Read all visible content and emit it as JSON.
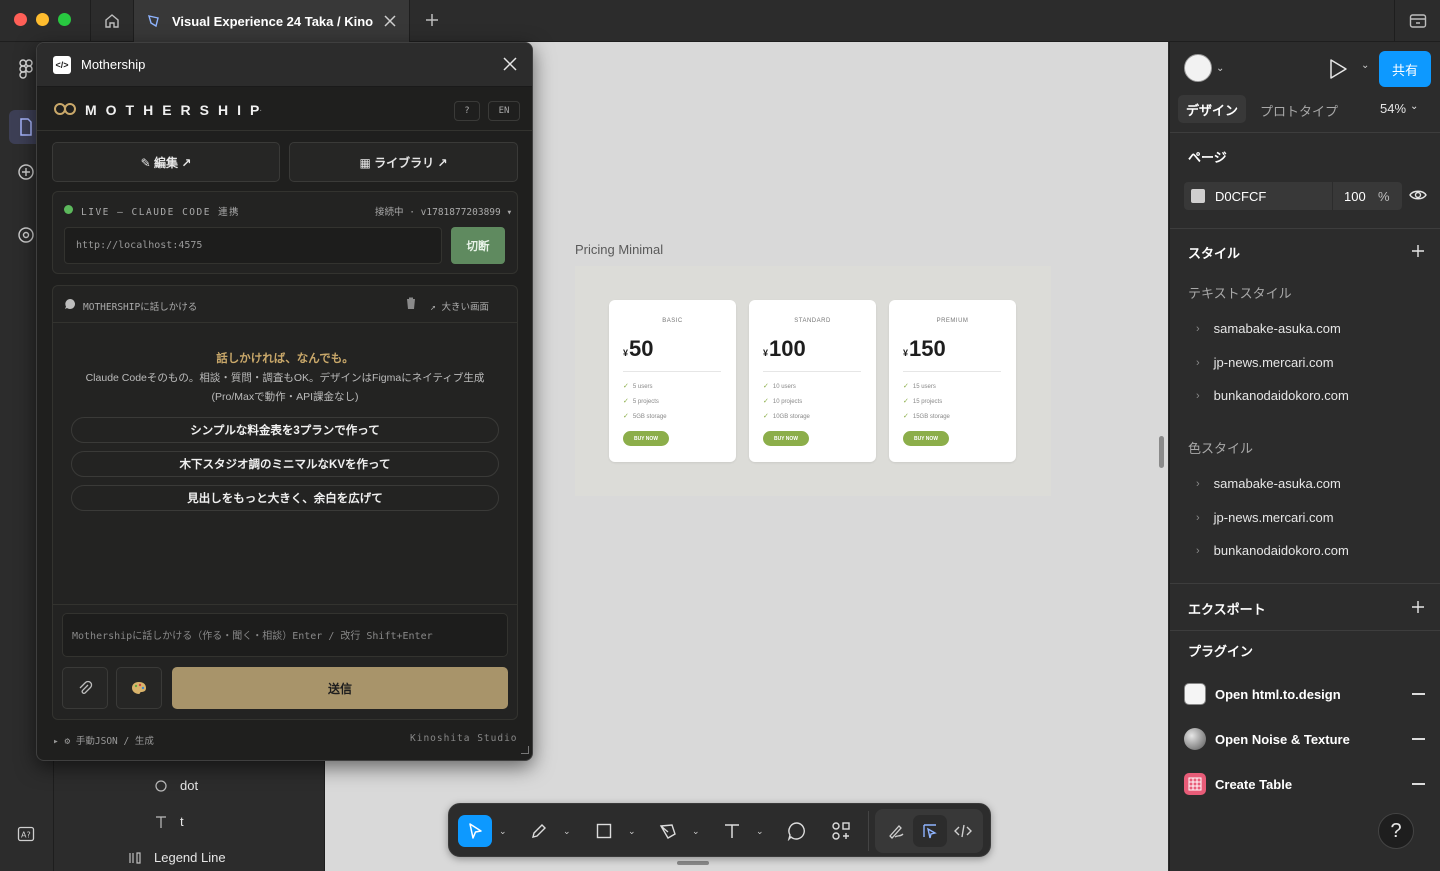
{
  "window": {
    "tab_title": "Visual Experience 24 Taka / Kino",
    "traffic_colors": [
      "#ff5f57",
      "#febc2e",
      "#28c840"
    ]
  },
  "layers": {
    "items": [
      {
        "label": "dot",
        "icon": "ellipse-icon"
      },
      {
        "label": "t",
        "icon": "text-icon"
      },
      {
        "label": "Legend Line",
        "icon": "frame-icon"
      }
    ]
  },
  "canvas": {
    "frame_label": "Pricing Minimal",
    "accent": "#8cae4a",
    "cards": [
      {
        "tier": "BASIC",
        "currency": "¥",
        "price": "50",
        "features": [
          "5 users",
          "5 projects",
          "5GB storage"
        ],
        "button": "BUY NOW"
      },
      {
        "tier": "STANDARD",
        "currency": "¥",
        "price": "100",
        "features": [
          "10 users",
          "10 projects",
          "10GB storage"
        ],
        "button": "BUY NOW"
      },
      {
        "tier": "PREMIUM",
        "currency": "¥",
        "price": "150",
        "features": [
          "15 users",
          "15 projects",
          "15GB storage"
        ],
        "button": "BUY NOW"
      }
    ]
  },
  "toolbar": {
    "tools": [
      "move-tool-icon",
      "pencil-icon",
      "rectangle-icon",
      "pen-icon",
      "text-tool-icon",
      "comment-icon",
      "actions-icon",
      "draw-mode-icon",
      "design-mode-icon",
      "dev-mode-icon"
    ]
  },
  "right": {
    "share_label": "共有",
    "share_color": "#0d99ff",
    "tabs": {
      "design": "デザイン",
      "prototype": "プロトタイプ"
    },
    "zoom": "54%",
    "page_section": "ページ",
    "bg_hex": "D0CFCF",
    "bg_opacity": "100",
    "bg_unit": "%",
    "styles_section": "スタイル",
    "text_styles": "テキストスタイル",
    "text_style_items": [
      "samabake-asuka.com",
      "jp-news.mercari.com",
      "bunkanodaidokoro.com"
    ],
    "color_styles": "色スタイル",
    "color_style_items": [
      "samabake-asuka.com",
      "jp-news.mercari.com",
      "bunkanodaidokoro.com"
    ],
    "export_section": "エクスポート",
    "plugins_section": "プラグイン",
    "plugins": [
      {
        "label": "Open html.to.design",
        "icon": "html-to-design-icon"
      },
      {
        "label": "Open Noise & Texture",
        "icon": "noise-texture-icon"
      },
      {
        "label": "Create Table",
        "icon": "table-icon"
      }
    ],
    "help": "?"
  },
  "modal": {
    "title": "Mothership",
    "brand": "MOTHERSHIP",
    "help_btn": "?",
    "lang_btn": "EN",
    "edit_btn": "✎ 編集 ↗",
    "library_btn": "▦ ライブラリ ↗",
    "live_label": "LIVE — CLAUDE CODE 連携",
    "status": "接続中 · v1781877203899 ▾",
    "url": "http://localhost:4575",
    "disconnect_btn": "切断",
    "chat_header": "MOTHERSHIPに話しかける",
    "expand_label": "↗ 大きい画面",
    "intro_title": "話しかければ、なんでも。",
    "intro_line1": "Claude Codeそのもの。相談・質問・調査もOK。デザインはFigmaにネイティブ生成",
    "intro_line2": "(Pro/Maxで動作・API課金なし)",
    "suggestions": [
      "シンプルな料金表を3プランで作って",
      "木下スタジオ調のミニマルなKVを作って",
      "見出しをもっと大きく、余白を広げて"
    ],
    "input_placeholder": "Mothershipに話しかける（作る・聞く・相談）Enter / 改行 Shift+Enter",
    "send_btn": "送信",
    "send_color": "#a8946a",
    "live_color": "#5cb85c",
    "footer_left": "▸ ⚙ 手動JSON / 生成",
    "footer_right": "Kinoshita Studio"
  }
}
